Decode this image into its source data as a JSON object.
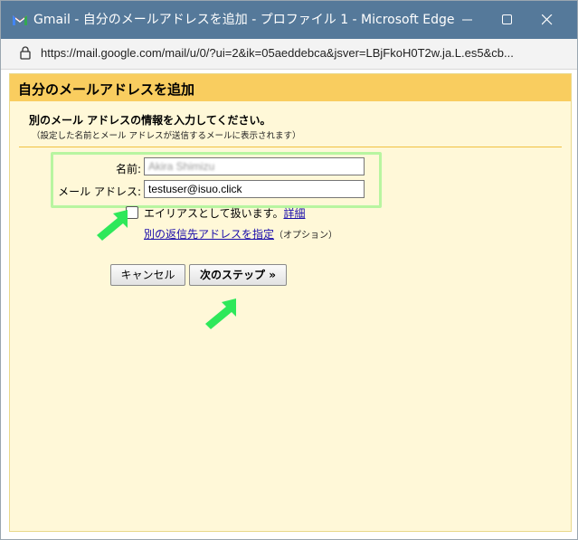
{
  "window": {
    "title": "Gmail - 自分のメールアドレスを追加 - プロファイル 1 - Microsoft Edge",
    "url": "https://mail.google.com/mail/u/0/?ui=2&ik=05aeddebca&jsver=LBjFkoH0T2w.ja.L.es5&cb..."
  },
  "dialog": {
    "title": "自分のメールアドレスを追加",
    "instruction": "別のメール アドレスの情報を入力してください。",
    "note": "（設定した名前とメール アドレスが送信するメールに表示されます）",
    "name_label": "名前:",
    "name_value": "Akira Shimizu",
    "email_label": "メール アドレス:",
    "email_value": "testuser@isuo.click",
    "alias_label": "エイリアスとして扱います。",
    "alias_checked": false,
    "details_link": "詳細",
    "reply_link": "別の返信先アドレスを指定",
    "reply_option": "（オプション）",
    "cancel_label": "キャンセル",
    "next_label": "次のステップ »"
  },
  "colors": {
    "titlebar": "#55799a",
    "header": "#f9cd5f",
    "panel": "#fff8d8",
    "highlight": "#b8f5a0",
    "arrow": "#2ee85a",
    "link": "#1a0dab"
  }
}
